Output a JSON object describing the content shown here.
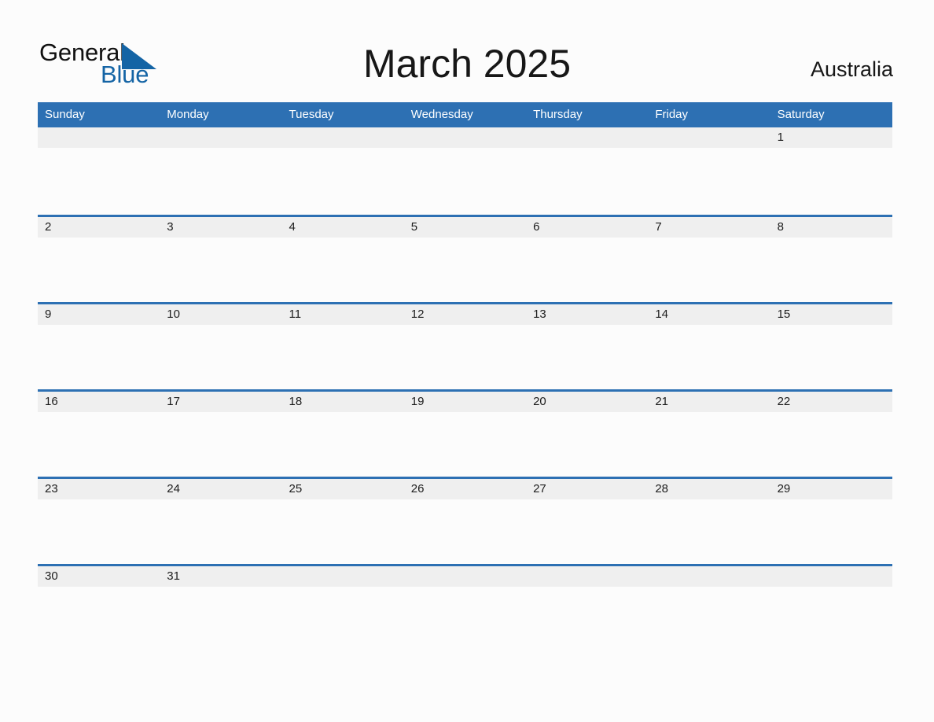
{
  "brand": {
    "name_part1": "General",
    "name_part2": "Blue",
    "triangle_icon": "triangle-icon",
    "blue_hex": "#1464a5"
  },
  "header": {
    "title": "March 2025",
    "month": "March",
    "year": "2025",
    "country": "Australia"
  },
  "theme": {
    "header_blue": "#2d70b3",
    "band_gray": "#efefef",
    "page_background": "#fcfcfc",
    "text_dark": "#1c1c1c"
  },
  "weekdays": [
    "Sunday",
    "Monday",
    "Tuesday",
    "Wednesday",
    "Thursday",
    "Friday",
    "Saturday"
  ],
  "weeks": [
    {
      "show_rule": false,
      "days": [
        "",
        "",
        "",
        "",
        "",
        "",
        "1"
      ]
    },
    {
      "show_rule": true,
      "days": [
        "2",
        "3",
        "4",
        "5",
        "6",
        "7",
        "8"
      ]
    },
    {
      "show_rule": true,
      "days": [
        "9",
        "10",
        "11",
        "12",
        "13",
        "14",
        "15"
      ]
    },
    {
      "show_rule": true,
      "days": [
        "16",
        "17",
        "18",
        "19",
        "20",
        "21",
        "22"
      ]
    },
    {
      "show_rule": true,
      "days": [
        "23",
        "24",
        "25",
        "26",
        "27",
        "28",
        "29"
      ]
    },
    {
      "show_rule": true,
      "days": [
        "30",
        "31",
        "",
        "",
        "",
        "",
        ""
      ]
    }
  ]
}
